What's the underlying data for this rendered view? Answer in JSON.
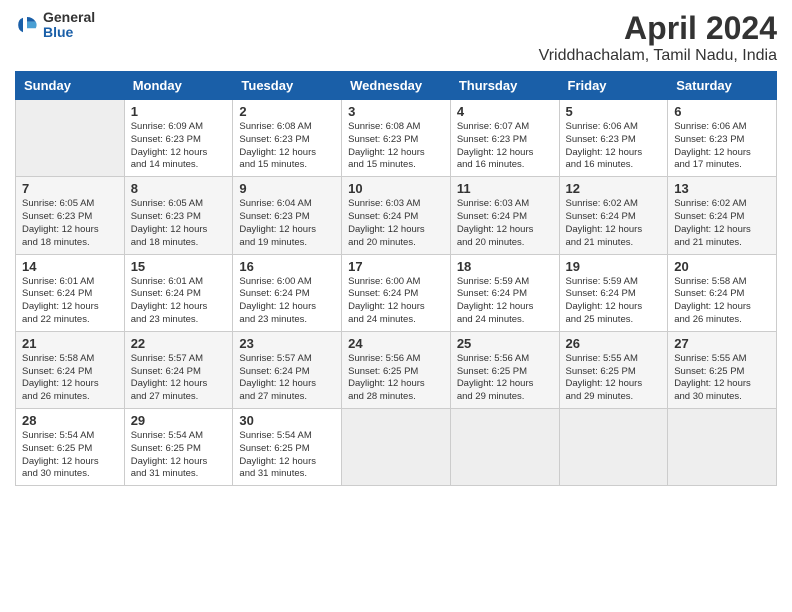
{
  "header": {
    "logo_general": "General",
    "logo_blue": "Blue",
    "title": "April 2024",
    "location": "Vriddhachalam, Tamil Nadu, India"
  },
  "weekdays": [
    "Sunday",
    "Monday",
    "Tuesday",
    "Wednesday",
    "Thursday",
    "Friday",
    "Saturday"
  ],
  "weeks": [
    [
      {
        "num": "",
        "info": ""
      },
      {
        "num": "1",
        "info": "Sunrise: 6:09 AM\nSunset: 6:23 PM\nDaylight: 12 hours\nand 14 minutes."
      },
      {
        "num": "2",
        "info": "Sunrise: 6:08 AM\nSunset: 6:23 PM\nDaylight: 12 hours\nand 15 minutes."
      },
      {
        "num": "3",
        "info": "Sunrise: 6:08 AM\nSunset: 6:23 PM\nDaylight: 12 hours\nand 15 minutes."
      },
      {
        "num": "4",
        "info": "Sunrise: 6:07 AM\nSunset: 6:23 PM\nDaylight: 12 hours\nand 16 minutes."
      },
      {
        "num": "5",
        "info": "Sunrise: 6:06 AM\nSunset: 6:23 PM\nDaylight: 12 hours\nand 16 minutes."
      },
      {
        "num": "6",
        "info": "Sunrise: 6:06 AM\nSunset: 6:23 PM\nDaylight: 12 hours\nand 17 minutes."
      }
    ],
    [
      {
        "num": "7",
        "info": "Sunrise: 6:05 AM\nSunset: 6:23 PM\nDaylight: 12 hours\nand 18 minutes."
      },
      {
        "num": "8",
        "info": "Sunrise: 6:05 AM\nSunset: 6:23 PM\nDaylight: 12 hours\nand 18 minutes."
      },
      {
        "num": "9",
        "info": "Sunrise: 6:04 AM\nSunset: 6:23 PM\nDaylight: 12 hours\nand 19 minutes."
      },
      {
        "num": "10",
        "info": "Sunrise: 6:03 AM\nSunset: 6:24 PM\nDaylight: 12 hours\nand 20 minutes."
      },
      {
        "num": "11",
        "info": "Sunrise: 6:03 AM\nSunset: 6:24 PM\nDaylight: 12 hours\nand 20 minutes."
      },
      {
        "num": "12",
        "info": "Sunrise: 6:02 AM\nSunset: 6:24 PM\nDaylight: 12 hours\nand 21 minutes."
      },
      {
        "num": "13",
        "info": "Sunrise: 6:02 AM\nSunset: 6:24 PM\nDaylight: 12 hours\nand 21 minutes."
      }
    ],
    [
      {
        "num": "14",
        "info": "Sunrise: 6:01 AM\nSunset: 6:24 PM\nDaylight: 12 hours\nand 22 minutes."
      },
      {
        "num": "15",
        "info": "Sunrise: 6:01 AM\nSunset: 6:24 PM\nDaylight: 12 hours\nand 23 minutes."
      },
      {
        "num": "16",
        "info": "Sunrise: 6:00 AM\nSunset: 6:24 PM\nDaylight: 12 hours\nand 23 minutes."
      },
      {
        "num": "17",
        "info": "Sunrise: 6:00 AM\nSunset: 6:24 PM\nDaylight: 12 hours\nand 24 minutes."
      },
      {
        "num": "18",
        "info": "Sunrise: 5:59 AM\nSunset: 6:24 PM\nDaylight: 12 hours\nand 24 minutes."
      },
      {
        "num": "19",
        "info": "Sunrise: 5:59 AM\nSunset: 6:24 PM\nDaylight: 12 hours\nand 25 minutes."
      },
      {
        "num": "20",
        "info": "Sunrise: 5:58 AM\nSunset: 6:24 PM\nDaylight: 12 hours\nand 26 minutes."
      }
    ],
    [
      {
        "num": "21",
        "info": "Sunrise: 5:58 AM\nSunset: 6:24 PM\nDaylight: 12 hours\nand 26 minutes."
      },
      {
        "num": "22",
        "info": "Sunrise: 5:57 AM\nSunset: 6:24 PM\nDaylight: 12 hours\nand 27 minutes."
      },
      {
        "num": "23",
        "info": "Sunrise: 5:57 AM\nSunset: 6:24 PM\nDaylight: 12 hours\nand 27 minutes."
      },
      {
        "num": "24",
        "info": "Sunrise: 5:56 AM\nSunset: 6:25 PM\nDaylight: 12 hours\nand 28 minutes."
      },
      {
        "num": "25",
        "info": "Sunrise: 5:56 AM\nSunset: 6:25 PM\nDaylight: 12 hours\nand 29 minutes."
      },
      {
        "num": "26",
        "info": "Sunrise: 5:55 AM\nSunset: 6:25 PM\nDaylight: 12 hours\nand 29 minutes."
      },
      {
        "num": "27",
        "info": "Sunrise: 5:55 AM\nSunset: 6:25 PM\nDaylight: 12 hours\nand 30 minutes."
      }
    ],
    [
      {
        "num": "28",
        "info": "Sunrise: 5:54 AM\nSunset: 6:25 PM\nDaylight: 12 hours\nand 30 minutes."
      },
      {
        "num": "29",
        "info": "Sunrise: 5:54 AM\nSunset: 6:25 PM\nDaylight: 12 hours\nand 31 minutes."
      },
      {
        "num": "30",
        "info": "Sunrise: 5:54 AM\nSunset: 6:25 PM\nDaylight: 12 hours\nand 31 minutes."
      },
      {
        "num": "",
        "info": ""
      },
      {
        "num": "",
        "info": ""
      },
      {
        "num": "",
        "info": ""
      },
      {
        "num": "",
        "info": ""
      }
    ]
  ]
}
